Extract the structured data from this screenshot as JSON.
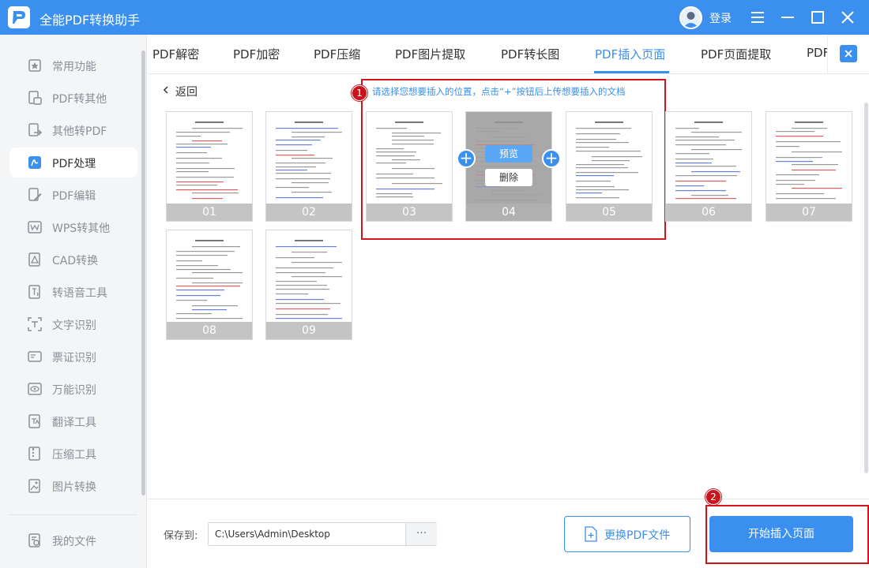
{
  "app": {
    "title": "全能PDF转换助手",
    "login": "登录"
  },
  "sidebar": {
    "items": [
      {
        "label": "常用功能",
        "icon": "star-box-icon"
      },
      {
        "label": "PDF转其他",
        "icon": "pdf-convert-icon"
      },
      {
        "label": "其他转PDF",
        "icon": "to-pdf-icon"
      },
      {
        "label": "PDF处理",
        "icon": "pdf-process-icon",
        "active": true
      },
      {
        "label": "PDF编辑",
        "icon": "pdf-edit-icon"
      },
      {
        "label": "WPS转其他",
        "icon": "wps-icon"
      },
      {
        "label": "CAD转换",
        "icon": "cad-icon"
      },
      {
        "label": "转语音工具",
        "icon": "speech-icon"
      },
      {
        "label": "文字识别",
        "icon": "ocr-icon"
      },
      {
        "label": "票证识别",
        "icon": "ticket-icon"
      },
      {
        "label": "万能识别",
        "icon": "eye-icon"
      },
      {
        "label": "翻译工具",
        "icon": "translate-icon"
      },
      {
        "label": "压缩工具",
        "icon": "zip-icon"
      },
      {
        "label": "图片转换",
        "icon": "image-icon"
      }
    ],
    "bottom": {
      "label": "我的文件",
      "icon": "my-files-icon"
    }
  },
  "tabs": [
    "PDF解密",
    "PDF加密",
    "PDF压缩",
    "PDF图片提取",
    "PDF转长图",
    "PDF插入页面",
    "PDF页面提取",
    "PDF"
  ],
  "active_tab": "PDF插入页面",
  "content": {
    "back": "返回",
    "hint": "请选择您想要插入的位置，点击“+”按钮后上传想要插入的文档",
    "marker1": "1",
    "marker2": "2",
    "pages": [
      "01",
      "02",
      "03",
      "04",
      "05",
      "06",
      "07",
      "08",
      "09"
    ],
    "hover_page": "04",
    "preview": "预览",
    "delete": "删除",
    "plus": "+"
  },
  "footer": {
    "save_label": "保存到:",
    "path": "C:\\Users\\Admin\\Desktop",
    "browse": "···",
    "replace": "更换PDF文件",
    "start": "开始插入页面"
  },
  "colors": {
    "accent": "#3a8fef",
    "highlight": "#d0151d",
    "sidebar_bg": "#f4f5f7"
  }
}
